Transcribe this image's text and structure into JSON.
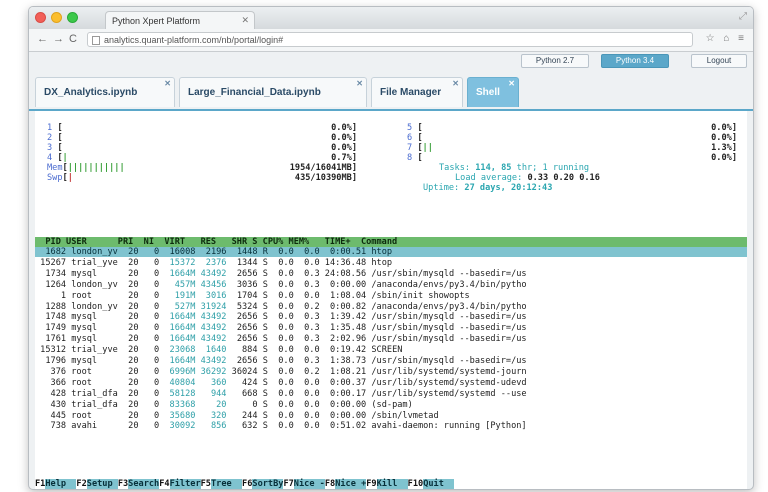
{
  "browser": {
    "tab_title": "Python Xpert Platform",
    "url": "analytics.quant-platform.com/nb/portal/login#",
    "nav_back": "←",
    "nav_forward": "→",
    "nav_reload": "C",
    "addr_right_icons": "☆ ⌂ ≡"
  },
  "toolbar": {
    "python27": "Python 2.7",
    "python34": "Python 3.4",
    "logout": "Logout"
  },
  "notebook_tabs": [
    {
      "label": "DX_Analytics.ipynb",
      "active": false
    },
    {
      "label": "Large_Financial_Data.ipynb",
      "active": false
    },
    {
      "label": "File Manager",
      "active": false
    },
    {
      "label": "Shell",
      "active": true
    }
  ],
  "htop": {
    "cpus_left": [
      {
        "num": "1",
        "bar": "",
        "pct": "0.0%]"
      },
      {
        "num": "2",
        "bar": "",
        "pct": "0.0%]"
      },
      {
        "num": "3",
        "bar": "",
        "pct": "0.0%]"
      },
      {
        "num": "4",
        "bar": "|",
        "pct": "0.7%]"
      }
    ],
    "cpus_right": [
      {
        "num": "5",
        "bar": "",
        "pct": "0.0%]"
      },
      {
        "num": "6",
        "bar": "",
        "pct": "0.0%]"
      },
      {
        "num": "7",
        "bar": "||",
        "pct": "1.3%]"
      },
      {
        "num": "8",
        "bar": "",
        "pct": "0.0%]"
      }
    ],
    "mem_label": "Mem",
    "mem_bar": "|||||||||||",
    "mem_value": "1954/16041MB]",
    "swp_label": "Swp",
    "swp_bar": "|",
    "swp_value": "435/10390MB]",
    "tasks_label": "Tasks:",
    "tasks_value": "114, 85",
    "tasks_extra": "thr; 1 running",
    "load_label": "Load average:",
    "load_value": "0.33 0.20 0.16",
    "uptime_label": "Uptime:",
    "uptime_value": "27 days, 20:12:43",
    "header": "  PID USER      PRI  NI  VIRT   RES   SHR S CPU% MEM%   TIME+  Command",
    "processes": [
      {
        "pid": " 1682",
        "user": "london_yv",
        "pri": " 20",
        "ni": "  0",
        "virt": "16008",
        "res": " 2196",
        "shr": " 1448",
        "s": "R",
        "cpu": " 0.0",
        "mem": " 0.0",
        "time": " 0:00.51",
        "cmd": "htop",
        "selected": true
      },
      {
        "pid": "15267",
        "user": "trial_yve",
        "pri": " 20",
        "ni": "  0",
        "virt": "15372",
        "res": " 2376",
        "shr": " 1344",
        "s": "S",
        "cpu": " 0.0",
        "mem": " 0.0",
        "time": "14:36.48",
        "cmd": "htop",
        "selected": false
      },
      {
        "pid": " 1734",
        "user": "mysql",
        "pri": " 20",
        "ni": "  0",
        "virt": "1664M",
        "res": "43492",
        "shr": " 2656",
        "s": "S",
        "cpu": " 0.0",
        "mem": " 0.3",
        "time": "24:08.56",
        "cmd": "/usr/sbin/mysqld --basedir=/us",
        "selected": false
      },
      {
        "pid": " 1264",
        "user": "london_yv",
        "pri": " 20",
        "ni": "  0",
        "virt": "457M",
        "res": "43456",
        "shr": " 3036",
        "s": "S",
        "cpu": " 0.0",
        "mem": " 0.3",
        "time": " 0:00.00",
        "cmd": "/anaconda/envs/py3.4/bin/pytho",
        "selected": false
      },
      {
        "pid": "    1",
        "user": "root",
        "pri": " 20",
        "ni": "  0",
        "virt": "191M",
        "res": " 3016",
        "shr": " 1704",
        "s": "S",
        "cpu": " 0.0",
        "mem": " 0.0",
        "time": " 1:08.04",
        "cmd": "/sbin/init showopts",
        "selected": false
      },
      {
        "pid": " 1288",
        "user": "london_yv",
        "pri": " 20",
        "ni": "  0",
        "virt": "527M",
        "res": "31924",
        "shr": " 5324",
        "s": "S",
        "cpu": " 0.0",
        "mem": " 0.2",
        "time": " 0:00.82",
        "cmd": "/anaconda/envs/py3.4/bin/pytho",
        "selected": false
      },
      {
        "pid": " 1748",
        "user": "mysql",
        "pri": " 20",
        "ni": "  0",
        "virt": "1664M",
        "res": "43492",
        "shr": " 2656",
        "s": "S",
        "cpu": " 0.0",
        "mem": " 0.3",
        "time": " 1:39.42",
        "cmd": "/usr/sbin/mysqld --basedir=/us",
        "selected": false
      },
      {
        "pid": " 1749",
        "user": "mysql",
        "pri": " 20",
        "ni": "  0",
        "virt": "1664M",
        "res": "43492",
        "shr": " 2656",
        "s": "S",
        "cpu": " 0.0",
        "mem": " 0.3",
        "time": " 1:35.48",
        "cmd": "/usr/sbin/mysqld --basedir=/us",
        "selected": false
      },
      {
        "pid": " 1761",
        "user": "mysql",
        "pri": " 20",
        "ni": "  0",
        "virt": "1664M",
        "res": "43492",
        "shr": " 2656",
        "s": "S",
        "cpu": " 0.0",
        "mem": " 0.3",
        "time": " 2:02.96",
        "cmd": "/usr/sbin/mysqld --basedir=/us",
        "selected": false
      },
      {
        "pid": "15312",
        "user": "trial_yve",
        "pri": " 20",
        "ni": "  0",
        "virt": "23068",
        "res": " 1640",
        "shr": "  884",
        "s": "S",
        "cpu": " 0.0",
        "mem": " 0.0",
        "time": " 0:19.42",
        "cmd": "SCREEN",
        "selected": false
      },
      {
        "pid": " 1796",
        "user": "mysql",
        "pri": " 20",
        "ni": "  0",
        "virt": "1664M",
        "res": "43492",
        "shr": " 2656",
        "s": "S",
        "cpu": " 0.0",
        "mem": " 0.3",
        "time": " 1:38.73",
        "cmd": "/usr/sbin/mysqld --basedir=/us",
        "selected": false
      },
      {
        "pid": "  376",
        "user": "root",
        "pri": " 20",
        "ni": "  0",
        "virt": "6996M",
        "res": "36292",
        "shr": "36024",
        "s": "S",
        "cpu": " 0.0",
        "mem": " 0.2",
        "time": " 1:08.21",
        "cmd": "/usr/lib/systemd/systemd-journ",
        "selected": false
      },
      {
        "pid": "  366",
        "user": "root",
        "pri": " 20",
        "ni": "  0",
        "virt": "40804",
        "res": "  360",
        "shr": "  424",
        "s": "S",
        "cpu": " 0.0",
        "mem": " 0.0",
        "time": " 0:00.37",
        "cmd": "/usr/lib/systemd/systemd-udevd",
        "selected": false
      },
      {
        "pid": "  428",
        "user": "trial_dfa",
        "pri": " 20",
        "ni": "  0",
        "virt": "58128",
        "res": "  944",
        "shr": "  668",
        "s": "S",
        "cpu": " 0.0",
        "mem": " 0.0",
        "time": " 0:00.17",
        "cmd": "/usr/lib/systemd/systemd --use",
        "selected": false
      },
      {
        "pid": "  430",
        "user": "trial_dfa",
        "pri": " 20",
        "ni": "  0",
        "virt": "83368",
        "res": "   20",
        "shr": "    0",
        "s": "S",
        "cpu": " 0.0",
        "mem": " 0.0",
        "time": " 0:00.00",
        "cmd": "(sd-pam)",
        "selected": false
      },
      {
        "pid": "  445",
        "user": "root",
        "pri": " 20",
        "ni": "  0",
        "virt": "35680",
        "res": "  320",
        "shr": "  244",
        "s": "S",
        "cpu": " 0.0",
        "mem": " 0.0",
        "time": " 0:00.00",
        "cmd": "/sbin/lvmetad",
        "selected": false
      },
      {
        "pid": "  738",
        "user": "avahi",
        "pri": " 20",
        "ni": "  0",
        "virt": "30092",
        "res": "  856",
        "shr": "  632",
        "s": "S",
        "cpu": " 0.0",
        "mem": " 0.0",
        "time": " 0:51.02",
        "cmd": "avahi-daemon: running [Python]",
        "selected": false
      }
    ],
    "function_keys": [
      {
        "key": "F1",
        "label": "Help"
      },
      {
        "key": "F2",
        "label": "Setup"
      },
      {
        "key": "F3",
        "label": "Search"
      },
      {
        "key": "F4",
        "label": "Filter"
      },
      {
        "key": "F5",
        "label": "Tree"
      },
      {
        "key": "F6",
        "label": "SortBy"
      },
      {
        "key": "F7",
        "label": "Nice -"
      },
      {
        "key": "F8",
        "label": "Nice +"
      },
      {
        "key": "F9",
        "label": "Kill"
      },
      {
        "key": "F10",
        "label": "Quit"
      }
    ]
  },
  "colors": {
    "accent": "#5ba7c9",
    "header_green": "#6dbb6d",
    "select_cyan": "#7fc3cf"
  }
}
